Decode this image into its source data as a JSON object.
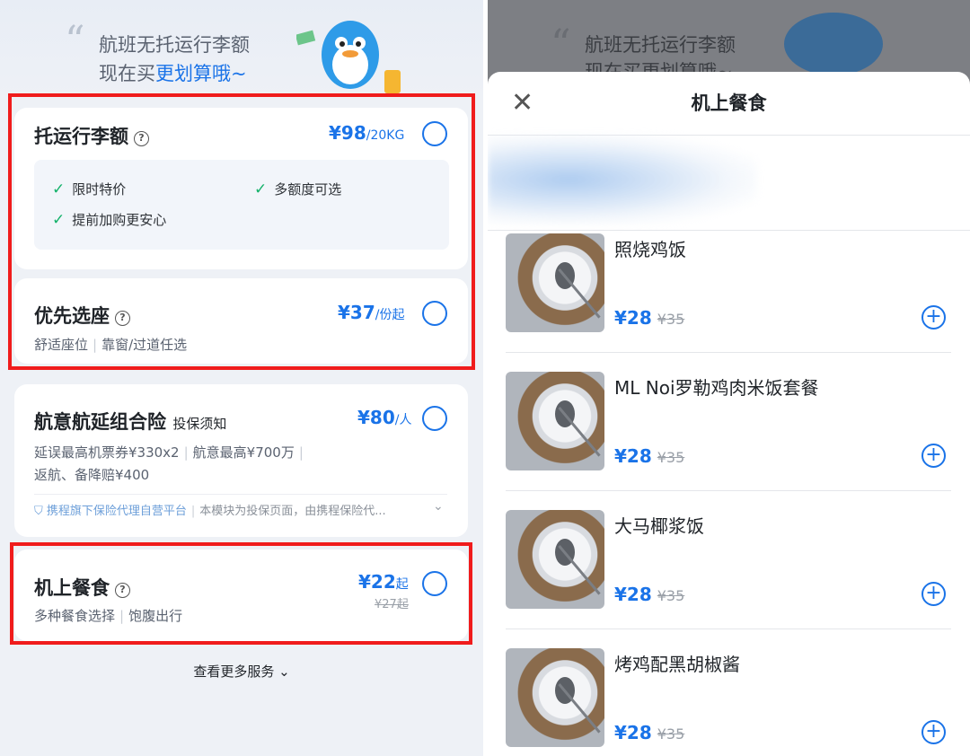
{
  "left": {
    "banner": {
      "line1": "航班无托运行李额",
      "line2_prefix": "现在买",
      "line2_highlight": "更划算哦~"
    },
    "baggage": {
      "title": "托运行李额",
      "price": "¥98",
      "unit": "/20KG",
      "features": [
        "限时特价",
        "多额度可选",
        "提前加购更安心"
      ]
    },
    "seat": {
      "title": "优先选座",
      "price": "¥37",
      "unit": "/份起",
      "sub1": "舒适座位",
      "sub2": "靠窗/过道任选"
    },
    "insurance": {
      "title": "航意航延组合险",
      "notice": "投保须知",
      "price": "¥80",
      "unit": "/人",
      "line1a": "延误最高机票券¥330x2",
      "line1b": "航意最高¥700万",
      "line2": "返航、备降赔¥400",
      "platform": "携程旗下保险代理自营平台",
      "disclaimer": "本模块为投保页面，由携程保险代..."
    },
    "meal": {
      "title": "机上餐食",
      "price": "¥22",
      "unit": "起",
      "old_price": "¥27起",
      "sub1": "多种餐食选择",
      "sub2": "饱腹出行"
    },
    "more": "查看更多服务"
  },
  "right": {
    "bg_banner_line1": "航班无托运行李额",
    "bg_banner_line2": "现在买更划算哦~",
    "sheet_title": "机上餐食",
    "meals": [
      {
        "name": "照烧鸡饭",
        "price": "¥28",
        "old": "¥35"
      },
      {
        "name": "ML Noi罗勒鸡肉米饭套餐",
        "price": "¥28",
        "old": "¥35"
      },
      {
        "name": "大马椰浆饭",
        "price": "¥28",
        "old": "¥35"
      },
      {
        "name": "烤鸡配黑胡椒酱",
        "price": "¥28",
        "old": "¥35"
      }
    ]
  },
  "colors": {
    "accent": "#1a73e8",
    "highlight_box": "#f01c1c",
    "check": "#14b26a"
  }
}
